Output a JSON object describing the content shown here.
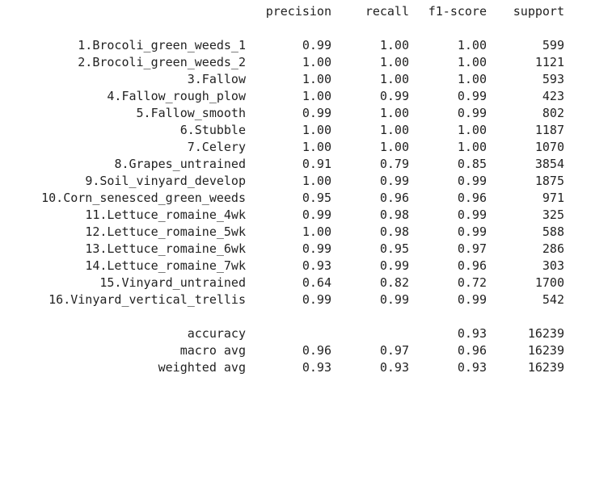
{
  "header": {
    "precision": "precision",
    "recall": "recall",
    "f1": "f1-score",
    "support": "support"
  },
  "classes": [
    {
      "label": "1.Brocoli_green_weeds_1",
      "precision": "0.99",
      "recall": "1.00",
      "f1": "1.00",
      "support": "599"
    },
    {
      "label": "2.Brocoli_green_weeds_2",
      "precision": "1.00",
      "recall": "1.00",
      "f1": "1.00",
      "support": "1121"
    },
    {
      "label": "3.Fallow",
      "precision": "1.00",
      "recall": "1.00",
      "f1": "1.00",
      "support": "593"
    },
    {
      "label": "4.Fallow_rough_plow",
      "precision": "1.00",
      "recall": "0.99",
      "f1": "0.99",
      "support": "423"
    },
    {
      "label": "5.Fallow_smooth",
      "precision": "0.99",
      "recall": "1.00",
      "f1": "0.99",
      "support": "802"
    },
    {
      "label": "6.Stubble",
      "precision": "1.00",
      "recall": "1.00",
      "f1": "1.00",
      "support": "1187"
    },
    {
      "label": "7.Celery",
      "precision": "1.00",
      "recall": "1.00",
      "f1": "1.00",
      "support": "1070"
    },
    {
      "label": "8.Grapes_untrained",
      "precision": "0.91",
      "recall": "0.79",
      "f1": "0.85",
      "support": "3854"
    },
    {
      "label": "9.Soil_vinyard_develop",
      "precision": "1.00",
      "recall": "0.99",
      "f1": "0.99",
      "support": "1875"
    },
    {
      "label": "10.Corn_senesced_green_weeds",
      "precision": "0.95",
      "recall": "0.96",
      "f1": "0.96",
      "support": "971"
    },
    {
      "label": "11.Lettuce_romaine_4wk",
      "precision": "0.99",
      "recall": "0.98",
      "f1": "0.99",
      "support": "325"
    },
    {
      "label": "12.Lettuce_romaine_5wk",
      "precision": "1.00",
      "recall": "0.98",
      "f1": "0.99",
      "support": "588"
    },
    {
      "label": "13.Lettuce_romaine_6wk",
      "precision": "0.99",
      "recall": "0.95",
      "f1": "0.97",
      "support": "286"
    },
    {
      "label": "14.Lettuce_romaine_7wk",
      "precision": "0.93",
      "recall": "0.99",
      "f1": "0.96",
      "support": "303"
    },
    {
      "label": "15.Vinyard_untrained",
      "precision": "0.64",
      "recall": "0.82",
      "f1": "0.72",
      "support": "1700"
    },
    {
      "label": "16.Vinyard_vertical_trellis",
      "precision": "0.99",
      "recall": "0.99",
      "f1": "0.99",
      "support": "542"
    }
  ],
  "summary": [
    {
      "label": "accuracy",
      "precision": "",
      "recall": "",
      "f1": "0.93",
      "support": "16239"
    },
    {
      "label": "macro avg",
      "precision": "0.96",
      "recall": "0.97",
      "f1": "0.96",
      "support": "16239"
    },
    {
      "label": "weighted avg",
      "precision": "0.93",
      "recall": "0.93",
      "f1": "0.93",
      "support": "16239"
    }
  ]
}
